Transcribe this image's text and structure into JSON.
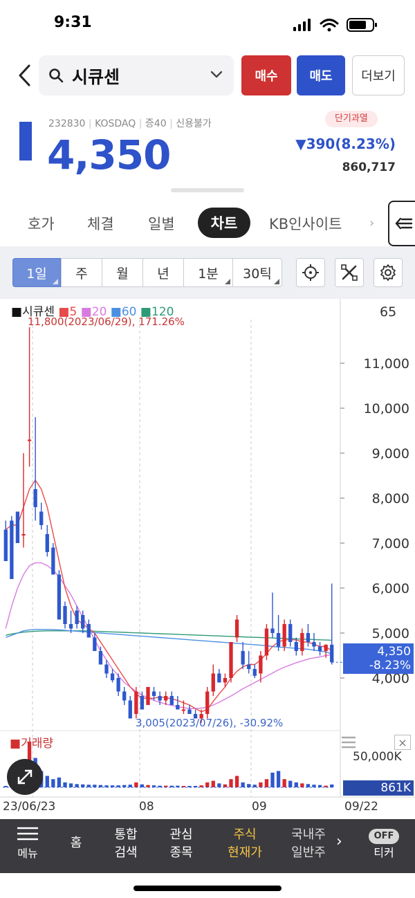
{
  "status": {
    "time": "9:31"
  },
  "header": {
    "stock_name": "시큐센",
    "buy_label": "매수",
    "sell_label": "매도",
    "more_label": "더보기"
  },
  "quote": {
    "code": "232830",
    "market": "KOSDAQ",
    "margin": "증40",
    "credit": "신용불가",
    "price": "4,350",
    "warning": "단기과열",
    "change": "▼390(8.23%)",
    "volume": "860,717",
    "accent": "#2e52c9"
  },
  "tabs": [
    "호가",
    "체결",
    "일별",
    "차트",
    "KB인사이트"
  ],
  "active_tab": "차트",
  "toolbar": {
    "periods": [
      "1일",
      "주",
      "월",
      "년",
      "1분",
      "30틱"
    ],
    "selected": "1일",
    "tools": [
      "crosshair-icon",
      "drawing-tools-icon",
      "gear-icon"
    ]
  },
  "chart": {
    "legend_name": "시큐센",
    "ma": [
      {
        "label": "5",
        "color": "#e84a4a"
      },
      {
        "label": "20",
        "color": "#d77be0"
      },
      {
        "label": "60",
        "color": "#4a90e2"
      },
      {
        "label": "120",
        "color": "#2e9a78"
      }
    ],
    "high_note": "11,800(2023/06/29), 171.26%",
    "low_note": "3,005(2023/07/26), -30.92%",
    "price_tag_value": "4,350",
    "price_tag_change": "-8.23%",
    "volume_label": "거래량",
    "volume_axis": "50,000K",
    "volume_tag": "861K",
    "x_labels": [
      "23/06/23",
      "08",
      "09",
      "09/22"
    ],
    "corner_value": "65"
  },
  "chart_data": {
    "type": "candlestick",
    "y_ticks": [
      11000,
      10000,
      9000,
      8000,
      7000,
      6000,
      5000,
      4000
    ],
    "y_tick_labels": [
      "11,000",
      "10,000",
      "9,000",
      "8,000",
      "7,000",
      "6,000",
      "5,000",
      "4,000"
    ],
    "ylim": [
      3000,
      12000
    ],
    "candles": [
      [
        7300,
        7500,
        7100,
        6600,
        7300
      ],
      [
        7500,
        7600,
        7100,
        6200,
        7500
      ],
      [
        7700,
        7700,
        7300,
        7000,
        7300
      ],
      [
        7200,
        9000,
        6900,
        7200,
        9200
      ],
      [
        9300,
        11800,
        8700,
        9300,
        9300
      ],
      [
        8200,
        9800,
        7500,
        7800,
        7900
      ],
      [
        7700,
        7900,
        7300,
        7400,
        7200
      ],
      [
        7200,
        7400,
        6700,
        6800,
        6800
      ],
      [
        6900,
        7000,
        6300,
        6300,
        6200
      ],
      [
        6300,
        6400,
        5300,
        5300,
        5600
      ],
      [
        5600,
        5700,
        5100,
        5200,
        5100
      ],
      [
        5200,
        5500,
        5000,
        5100,
        5300
      ],
      [
        5500,
        5600,
        5100,
        5200,
        5400
      ],
      [
        5400,
        5500,
        5000,
        5100,
        5200
      ],
      [
        5200,
        5300,
        4900,
        4900,
        5100
      ],
      [
        4900,
        5000,
        4600,
        4600,
        4800
      ],
      [
        4600,
        4700,
        4300,
        4300,
        4500
      ],
      [
        4300,
        4400,
        4000,
        4100,
        4200
      ],
      [
        4100,
        4200,
        3900,
        3950,
        4000
      ],
      [
        4000,
        4100,
        3600,
        3700,
        3900
      ],
      [
        3700,
        3800,
        3400,
        3500,
        3600
      ],
      [
        3500,
        3600,
        3100,
        3100,
        3300
      ],
      [
        3200,
        3800,
        3100,
        3700,
        3800
      ],
      [
        3600,
        3700,
        3300,
        3300,
        3500
      ],
      [
        3400,
        3800,
        3400,
        3800,
        3700
      ],
      [
        3700,
        3800,
        3500,
        3600,
        3600
      ],
      [
        3600,
        3700,
        3400,
        3500,
        3500
      ],
      [
        3500,
        3700,
        3400,
        3600,
        3600
      ],
      [
        3600,
        3700,
        3400,
        3400,
        3500
      ],
      [
        3400,
        3600,
        3300,
        3300,
        3400
      ],
      [
        3300,
        3500,
        3200,
        3300,
        3300
      ],
      [
        3300,
        3400,
        3200,
        3200,
        3300
      ],
      [
        3200,
        3300,
        3100,
        3100,
        3200
      ],
      [
        3100,
        3300,
        3005,
        3200,
        3300
      ],
      [
        3200,
        3800,
        3100,
        3700,
        3800
      ],
      [
        3700,
        4300,
        3600,
        4100,
        4200
      ],
      [
        4100,
        4200,
        3900,
        3900,
        4000
      ],
      [
        3900,
        4100,
        3800,
        4000,
        4000
      ],
      [
        4000,
        4800,
        3900,
        4800,
        4800
      ],
      [
        4900,
        5400,
        4800,
        5300,
        5300
      ],
      [
        4600,
        4800,
        4200,
        4300,
        4600
      ],
      [
        4300,
        4600,
        4100,
        4200,
        4400
      ],
      [
        4200,
        4300,
        4000,
        4050,
        4200
      ],
      [
        4100,
        4600,
        3900,
        4500,
        4500
      ],
      [
        4500,
        5200,
        4400,
        5100,
        5200
      ],
      [
        5100,
        5900,
        4900,
        5000,
        5700
      ],
      [
        5000,
        5400,
        4600,
        4700,
        5300
      ],
      [
        4700,
        5300,
        4600,
        5200,
        5200
      ],
      [
        5200,
        5300,
        4700,
        4800,
        5000
      ],
      [
        4800,
        4900,
        4500,
        4600,
        4700
      ],
      [
        4600,
        5100,
        4500,
        5000,
        5000
      ],
      [
        5000,
        5200,
        4700,
        4800,
        4900
      ],
      [
        4800,
        5000,
        4600,
        4700,
        4800
      ],
      [
        4700,
        4800,
        4500,
        4600,
        4700
      ],
      [
        4600,
        4750,
        4450,
        4740,
        4700
      ],
      [
        4740,
        6100,
        4300,
        4350,
        4350
      ]
    ],
    "ma5": [
      7300,
      7400,
      7400,
      7800,
      8200,
      8400,
      8200,
      7800,
      7200,
      6600,
      6000,
      5600,
      5300,
      5200,
      5100,
      5000,
      4800,
      4600,
      4400,
      4200,
      4000,
      3800,
      3650,
      3550,
      3550,
      3550,
      3580,
      3560,
      3540,
      3500,
      3450,
      3400,
      3320,
      3250,
      3300,
      3480,
      3650,
      3800,
      4000,
      4150,
      4250,
      4300,
      4300,
      4400,
      4550,
      4700,
      4800,
      4850,
      4850,
      4850,
      4800,
      4800,
      4750,
      4700,
      4700,
      4600
    ],
    "ma20": [
      5100,
      5600,
      6000,
      6300,
      6500,
      6560,
      6560,
      6500,
      6400,
      6250,
      6050,
      5850,
      5600,
      5350,
      5100,
      4850,
      4600,
      4400,
      4200,
      4050,
      3900,
      3800,
      3700,
      3620,
      3560,
      3500,
      3460,
      3420,
      3390,
      3360,
      3340,
      3320,
      3320,
      3330,
      3350,
      3400,
      3460,
      3530,
      3600,
      3680,
      3760,
      3830,
      3900,
      3970,
      4040,
      4110,
      4180,
      4240,
      4290,
      4340,
      4380,
      4420,
      4450,
      4470,
      4500,
      4520
    ],
    "ma60": [
      4900,
      4950,
      5000,
      5050,
      5070,
      5080,
      5080,
      5080,
      5075,
      5070,
      5060,
      5050,
      5040,
      5030,
      5020,
      5010,
      5000,
      4990,
      4980,
      4970,
      4960,
      4950,
      4940,
      4930,
      4920,
      4910,
      4900,
      4890,
      4880,
      4870,
      4860,
      4850,
      4840,
      4830,
      4820,
      4810,
      4800,
      4790,
      4780,
      4770,
      4760,
      4750,
      4740,
      4730,
      4720,
      4700,
      4690,
      4680,
      4670,
      4660,
      4650,
      4640,
      4620,
      4600,
      4580,
      4540
    ],
    "ma120": [
      4950,
      4980,
      5000,
      5020,
      5030,
      5040,
      5045,
      5050,
      5050,
      5050,
      5050,
      5050,
      5050,
      5050,
      5045,
      5040,
      5035,
      5030,
      5025,
      5020,
      5015,
      5010,
      5005,
      5000,
      4995,
      4990,
      4985,
      4980,
      4975,
      4970,
      4965,
      4960,
      4955,
      4950,
      4945,
      4940,
      4935,
      4930,
      4925,
      4920,
      4915,
      4910,
      4905,
      4900,
      4895,
      4890,
      4885,
      4880,
      4875,
      4870,
      4865,
      4860,
      4855,
      4850,
      4845,
      4840
    ],
    "volumes": [
      300,
      500,
      600,
      6000,
      14000,
      9000,
      5000,
      3500,
      2500,
      3000,
      1500,
      1200,
      1000,
      900,
      800,
      800,
      700,
      600,
      600,
      600,
      700,
      800,
      1500,
      900,
      700,
      600,
      500,
      500,
      500,
      500,
      400,
      400,
      400,
      600,
      1500,
      2000,
      1200,
      900,
      2500,
      3500,
      1500,
      1000,
      800,
      1500,
      2500,
      4500,
      5000,
      2500,
      2000,
      1500,
      1200,
      1000,
      800,
      700,
      500,
      860
    ]
  },
  "bottom_nav": {
    "items": [
      "메뉴",
      "홈",
      "통합\n검색",
      "관심\n종목",
      "주식\n현재가",
      "국내주\n일반주"
    ],
    "ticker_label": "티커",
    "ticker_state": "OFF",
    "highlight": "#f6c544"
  }
}
